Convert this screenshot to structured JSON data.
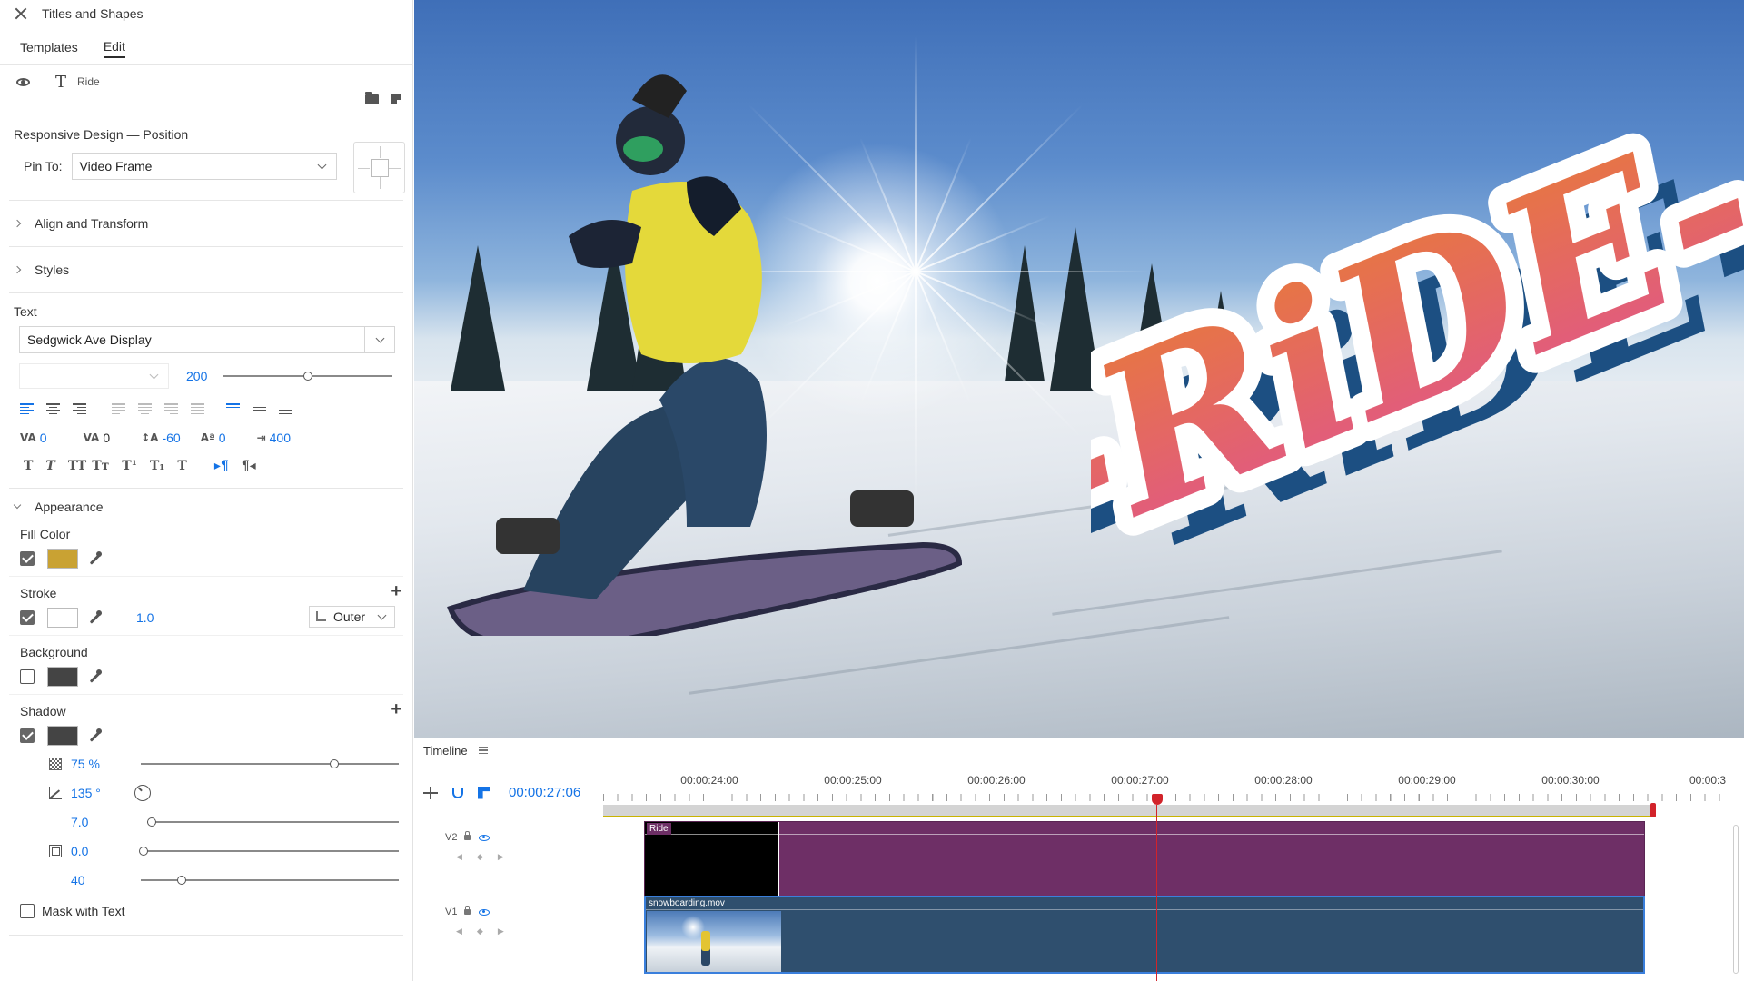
{
  "panel": {
    "title": "Titles and Shapes",
    "tabs": [
      {
        "label": "Templates",
        "active": false
      },
      {
        "label": "Edit",
        "active": true
      }
    ],
    "layer": {
      "name": "Ride"
    },
    "responsive": {
      "heading": "Responsive Design — Position",
      "pin_label": "Pin To:",
      "pin_value": "Video Frame"
    },
    "sections": {
      "align_transform": "Align and Transform",
      "styles": "Styles"
    },
    "text": {
      "heading": "Text",
      "font": "Sedgwick Ave Display",
      "size": "200",
      "size_slider": 0.5,
      "kerning": "0",
      "tracking": "0",
      "leading": "-60",
      "baseline": "0",
      "tab_width": "400"
    },
    "appearance": {
      "heading": "Appearance",
      "fill": {
        "label": "Fill Color",
        "checked": true,
        "color": "#c9a233"
      },
      "stroke": {
        "label": "Stroke",
        "checked": true,
        "color": "#ffffff",
        "width": "1.0",
        "type": "Outer"
      },
      "background": {
        "label": "Background",
        "checked": false,
        "color": "#444444"
      },
      "shadow": {
        "label": "Shadow",
        "checked": true,
        "color": "#444444",
        "opacity": "75",
        "opacity_unit": "%",
        "opacity_level": 0.75,
        "angle": "135",
        "angle_unit": "°",
        "distance": "7.0",
        "size": "0.0",
        "blur": "40"
      },
      "mask_label": "Mask with Text"
    }
  },
  "preview": {
    "title_text": "-RiDE-",
    "title_gradient": [
      "#e87a3a",
      "#e0568a"
    ],
    "stroke_color": "#ffffff",
    "shadow_color": "#1c4f82"
  },
  "timeline": {
    "title": "Timeline",
    "timecode": "00:00:27:06",
    "ruler_labels": [
      "00:00:24:00",
      "00:00:25:00",
      "00:00:26:00",
      "00:00:27:00",
      "00:00:28:00",
      "00:00:29:00",
      "00:00:30:00",
      "00:00:3"
    ],
    "tracks": [
      {
        "name": "V2",
        "clip": "Ride",
        "color": "#6e2f66"
      },
      {
        "name": "V1",
        "clip": "snowboarding.mov",
        "color": "#2f4f6e"
      }
    ]
  }
}
